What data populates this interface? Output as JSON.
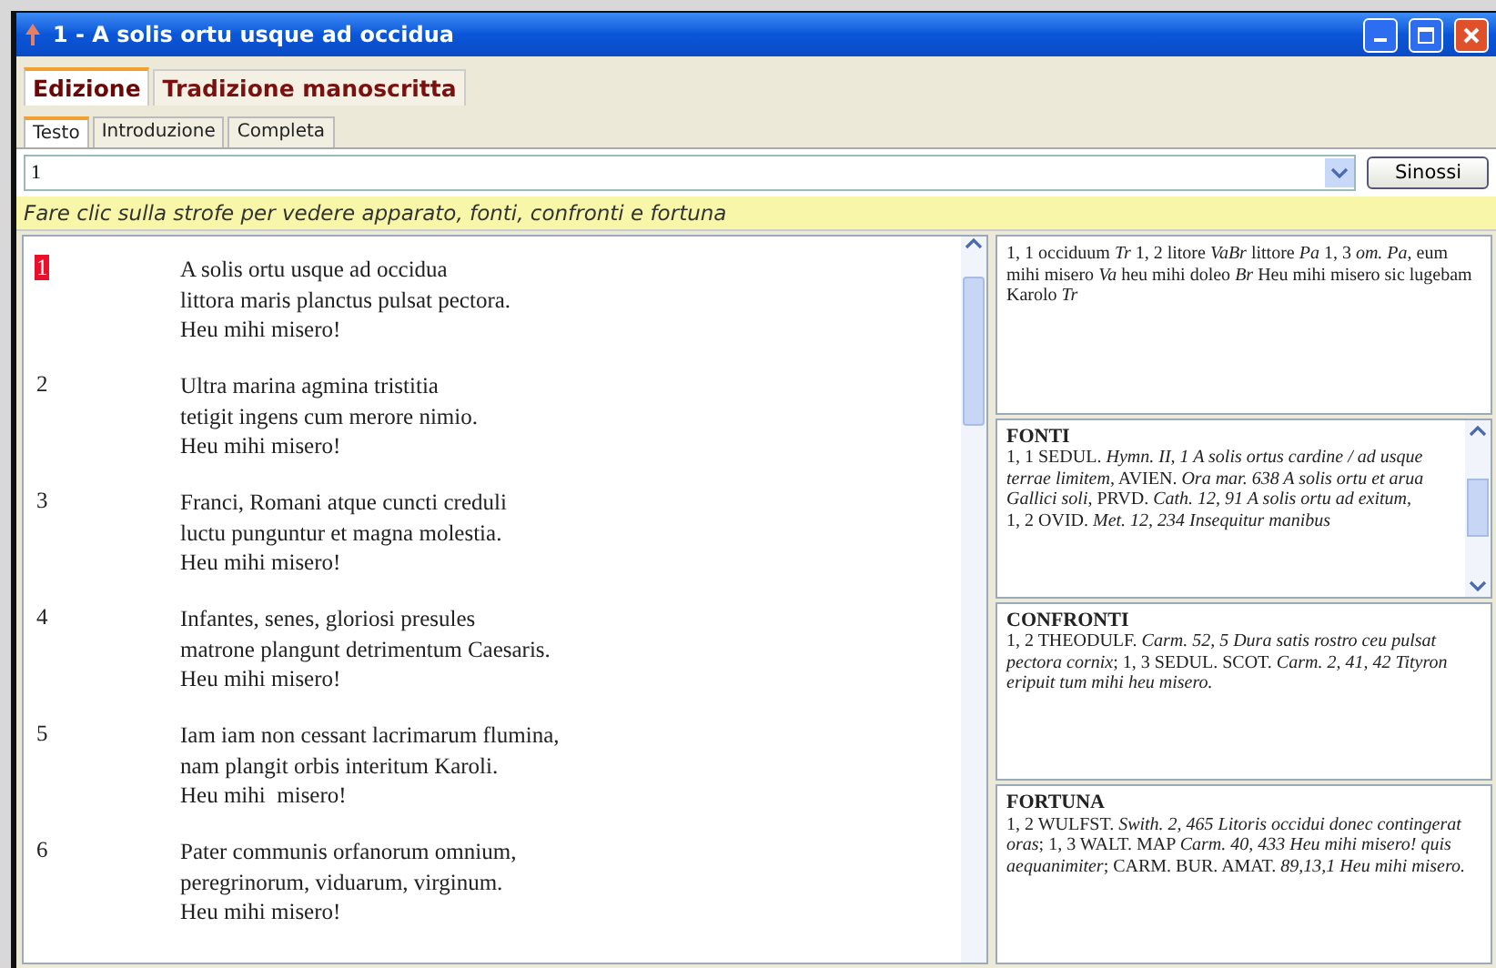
{
  "window": {
    "title": "1 - A solis ortu usque ad occidua"
  },
  "main_tabs": [
    {
      "label": "Edizione",
      "selected": true
    },
    {
      "label": "Tradizione manoscritta",
      "selected": false
    }
  ],
  "sub_tabs": [
    {
      "label": "Testo",
      "selected": true
    },
    {
      "label": "Introduzione",
      "selected": false
    },
    {
      "label": "Completa",
      "selected": false
    }
  ],
  "strophe_select": {
    "value": "1"
  },
  "sinossi_button": "Sinossi",
  "hint": "Fare clic sulla strofe per vedere apparato, fonti, confronti e fortuna",
  "stanzas": [
    {
      "number": "1",
      "selected": true,
      "lines": [
        "A solis ortu usque ad occidua",
        "littora maris planctus pulsat pectora.",
        "Heu mihi misero!"
      ]
    },
    {
      "number": "2",
      "selected": false,
      "lines": [
        "Ultra marina agmina tristitia",
        "tetigit ingens cum merore nimio.",
        "Heu mihi misero!"
      ]
    },
    {
      "number": "3",
      "selected": false,
      "lines": [
        "Franci, Romani atque cuncti creduli",
        "luctu punguntur et magna molestia.",
        "Heu mihi misero!"
      ]
    },
    {
      "number": "4",
      "selected": false,
      "lines": [
        "Infantes, senes, gloriosi presules",
        "matrone plangunt detrimentum Caesaris.",
        "Heu mihi misero!"
      ]
    },
    {
      "number": "5",
      "selected": false,
      "lines": [
        "Iam iam non cessant lacrimarum flumina,",
        "nam plangit orbis interitum Karoli.",
        "Heu mihi  misero!"
      ]
    },
    {
      "number": "6",
      "selected": false,
      "lines": [
        "Pater communis orfanorum omnium,",
        "peregrinorum, viduarum, virginum.",
        "Heu mihi misero!"
      ]
    }
  ],
  "panels": [
    {
      "paragraphs": [
        "1, 1 occiduum *Tr*  1, 2 litore *VaBr* littore *Pa*  1, 3 *om. Pa*, eum mihi misero *Va*  heu mihi doleo *Br* Heu mihi misero sic lugebam Karolo *Tr*"
      ]
    },
    {
      "heading": "FONTI",
      "scrollable": true,
      "paragraphs": [
        "1, 1 SEDUL. *Hymn. II, 1 A solis ortus cardine / ad usque terrae limitem*, AVIEN. *Ora mar. 638 A solis ortu et arua Gallici soli*, PRVD. *Cath. 12, 91 A solis ortu ad exitum*,",
        "1, 2 OVID. *Met. 12, 234 Insequitur manibus*"
      ]
    },
    {
      "heading": "CONFRONTI",
      "paragraphs": [
        "1, 2 THEODULF. *Carm. 52, 5 Dura satis rostro ceu pulsat pectora cornix*; 1, 3 SEDUL. SCOT. *Carm. 2, 41, 42 Tityron eripuit tum mihi heu misero.*"
      ]
    },
    {
      "heading": "FORTUNA",
      "paragraphs": [
        "1, 2 WULFST. *Swith. 2, 465 Litoris occidui donec contingerat oras*; 1, 3 WALT. MAP *Carm. 40, 433 Heu mihi misero! quis aequanimiter*; CARM. BUR. AMAT. *89,13,1 Heu mihi misero.*"
      ]
    }
  ]
}
